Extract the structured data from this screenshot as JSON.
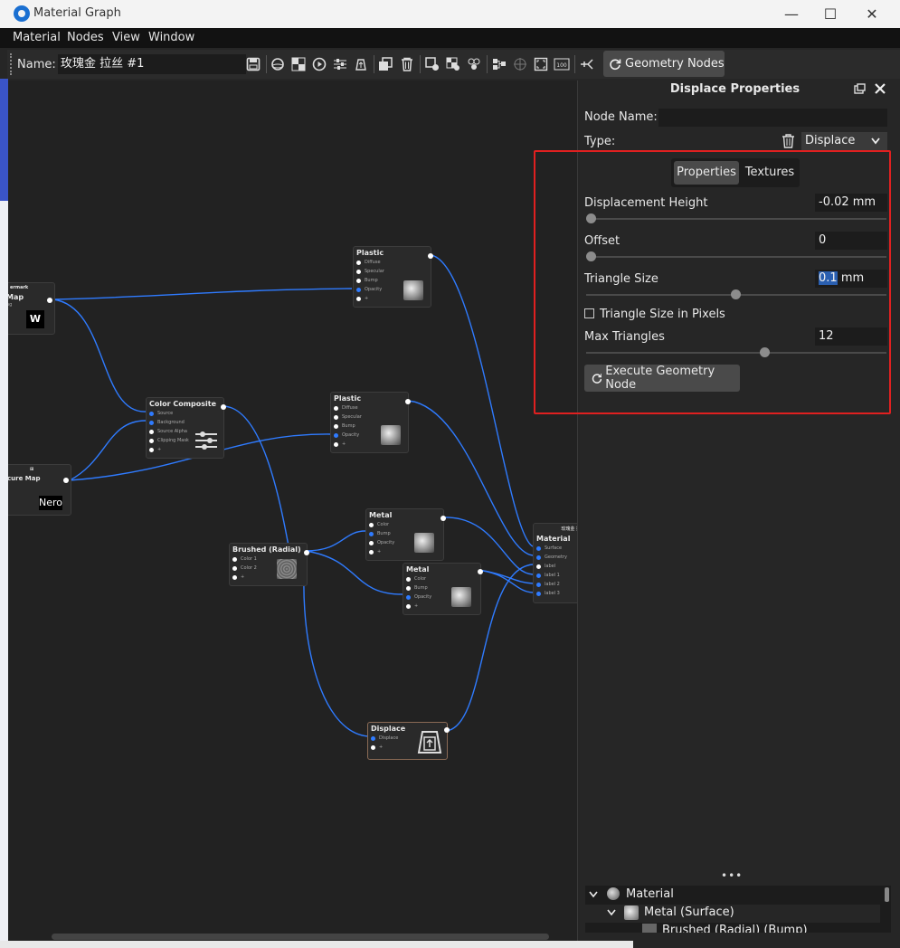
{
  "window": {
    "title": "Material Graph",
    "controls": {
      "minimize": "—",
      "maximize": "☐",
      "close": "✕"
    }
  },
  "menu": [
    "Material",
    "Nodes",
    "View",
    "Window"
  ],
  "toolbar": {
    "name_label": "Name:",
    "name_value": "玫瑰金 拉丝 #1",
    "geometry_nodes_label": "Geometry Nodes"
  },
  "graph": {
    "nodes": {
      "watermark": {
        "header": "ermark",
        "title": "Map",
        "port": "ng"
      },
      "texture_map": {
        "header": "⊞",
        "title": "cure Map",
        "thumb_text": "Nero"
      },
      "plastic1": {
        "title": "Plastic",
        "ports": [
          "Diffuse",
          "Specular",
          "Bump",
          "Opacity",
          "+"
        ]
      },
      "plastic2": {
        "title": "Plastic",
        "ports": [
          "Diffuse",
          "Specular",
          "Bump",
          "Opacity",
          "+"
        ]
      },
      "color_composite": {
        "title": "Color Composite",
        "ports": [
          "Source",
          "Background",
          "Source Alpha",
          "Clipping Mask",
          "+"
        ]
      },
      "metal1": {
        "title": "Metal",
        "ports": [
          "Color",
          "Bump",
          "Opacity",
          "+"
        ]
      },
      "metal2": {
        "title": "Metal",
        "ports": [
          "Color",
          "Bump",
          "Opacity",
          "+"
        ]
      },
      "brushed": {
        "title": "Brushed (Radial)",
        "ports": [
          "Color 1",
          "Color 2",
          "+"
        ]
      },
      "displace": {
        "title": "Displace",
        "ports": [
          "Displace",
          "+"
        ]
      },
      "material": {
        "header": "玫瑰金 拉丝",
        "title": "Material",
        "ports": [
          "Surface",
          "Geometry",
          "label",
          "label 1",
          "label 2",
          "label 3"
        ]
      }
    }
  },
  "panel": {
    "title": "Displace Properties",
    "node_name_label": "Node Name:",
    "node_name_value": "",
    "type_label": "Type:",
    "type_value": "Displace",
    "tabs": [
      "Properties",
      "Textures"
    ],
    "active_tab": "Properties",
    "displacement_height": {
      "label": "Displacement Height",
      "value": "-0.02 mm",
      "slider": 0.0
    },
    "offset": {
      "label": "Offset",
      "value": "0",
      "slider": 0.0
    },
    "triangle_size": {
      "label": "Triangle Size",
      "value_selected": "0.1",
      "unit": "mm",
      "slider": 0.5
    },
    "triangle_size_pixels": {
      "label": "Triangle Size in Pixels",
      "checked": false
    },
    "max_triangles": {
      "label": "Max Triangles",
      "value": "12",
      "slider": 0.6
    },
    "execute_label": "Execute Geometry Node",
    "more": "•••",
    "tree": [
      {
        "label": "Material",
        "level": 0
      },
      {
        "label": "Metal (Surface)",
        "level": 1
      },
      {
        "label": "Brushed (Radial) (Bump)",
        "level": 2
      }
    ]
  },
  "colors": {
    "accent_blue": "#2f7bff",
    "highlight_red": "#e02020",
    "background": "#262626"
  }
}
